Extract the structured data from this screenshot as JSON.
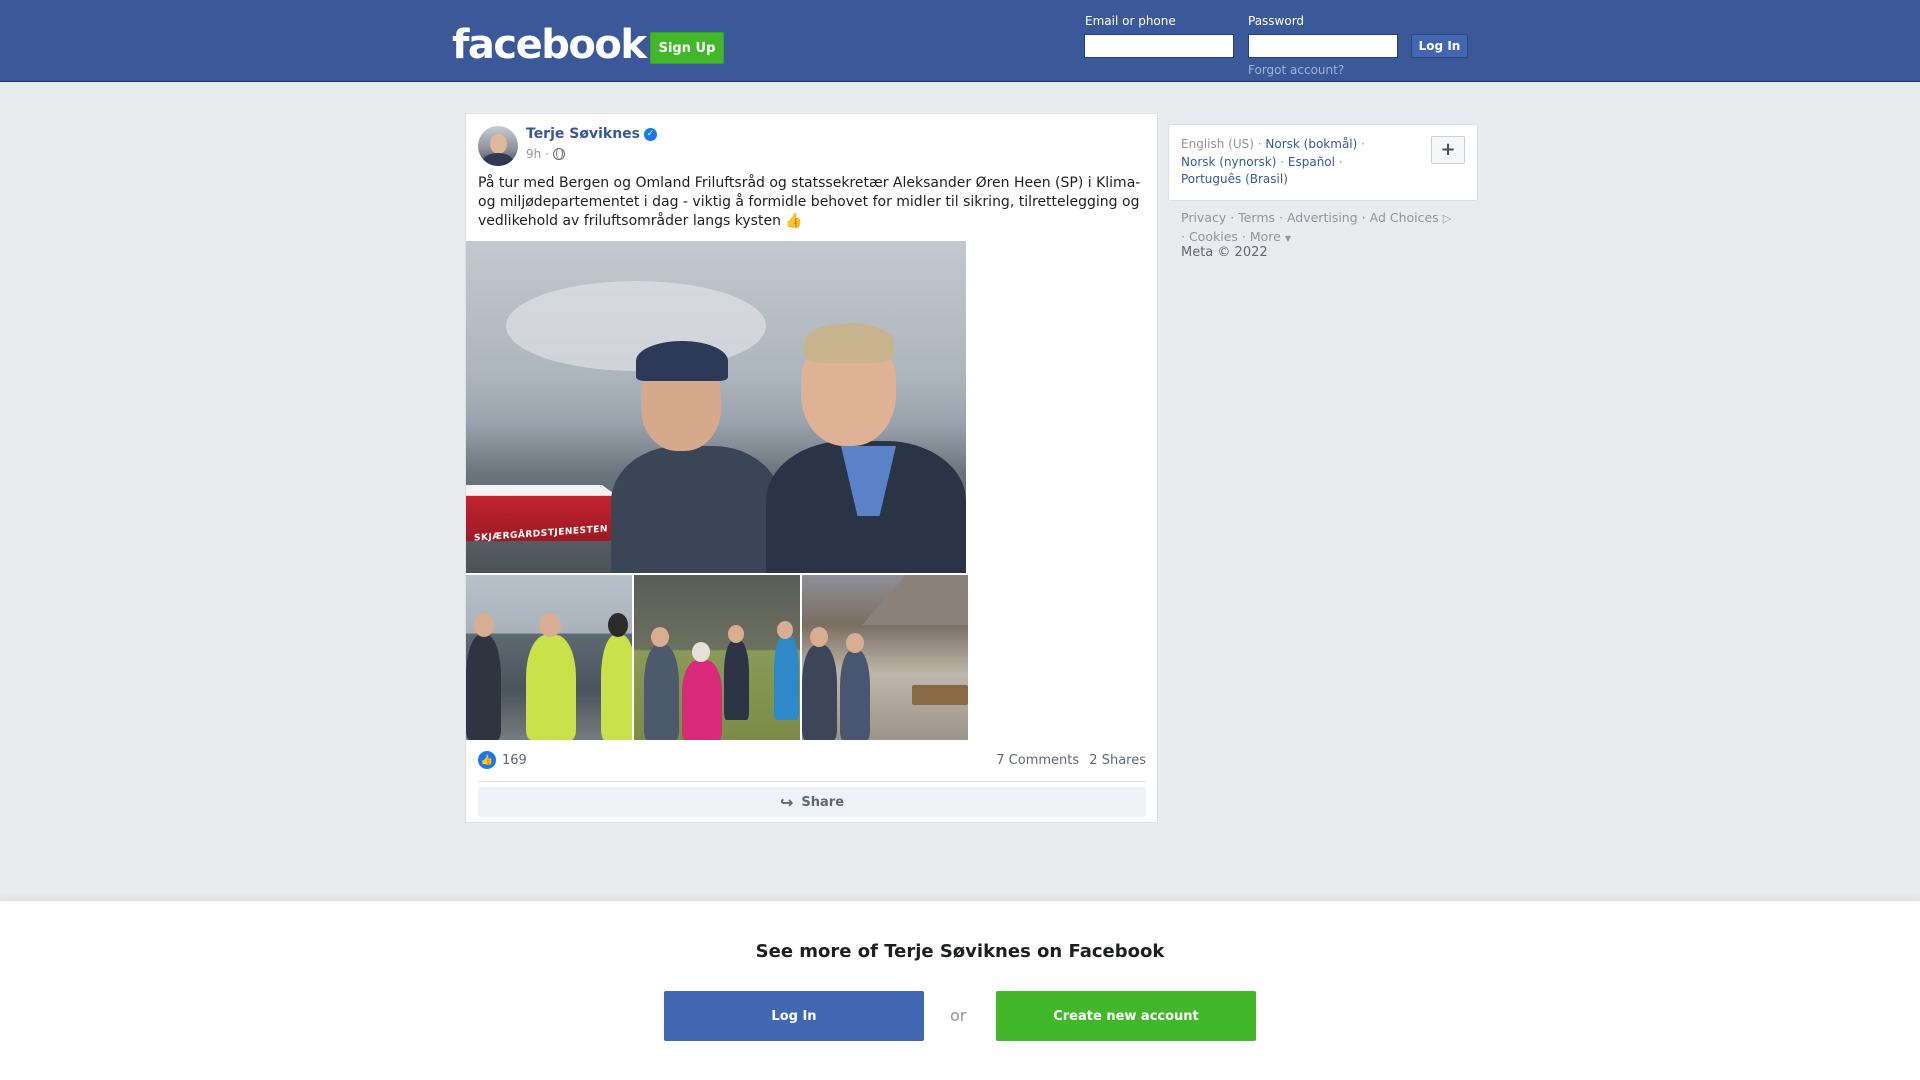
{
  "header": {
    "logo": "facebook",
    "signup_label": "Sign Up",
    "email_label": "Email or phone",
    "email_value": "",
    "password_label": "Password",
    "password_value": "",
    "login_label": "Log In",
    "forgot_label": "Forgot account?"
  },
  "post": {
    "author": "Terje Søviknes",
    "verified_icon": "verified-badge-icon",
    "time": "9h",
    "separator": "·",
    "privacy_icon": "globe-icon",
    "text": "På tur med Bergen og Omland Friluftsråd og statssekretær Aleksander Øren Heen (SP) i Klima- og miljødepartementet i dag - viktig å formidle behovet for midler til sikring, tilrettelegging og vedlikehold av friluftsområder langs kysten 👍",
    "photo_boat_text": "SKJÆRGÅRDSTJENESTEN",
    "likes": "169",
    "comments": "7 Comments",
    "shares": "2 Shares",
    "share_label": "Share"
  },
  "sidebar": {
    "languages": {
      "current": "English (US)",
      "links": [
        "Norsk (bokmål)",
        "Norsk (nynorsk)",
        "Español",
        "Português (Brasil)"
      ],
      "plus": "+"
    },
    "footer": {
      "links": [
        "Privacy",
        "Terms",
        "Advertising",
        "Ad Choices",
        "Cookies",
        "More"
      ],
      "copyright": "Meta © 2022"
    }
  },
  "banner": {
    "title": "See more of Terje Søviknes on Facebook",
    "login_label": "Log In",
    "or_label": "or",
    "create_label": "Create new account"
  },
  "colors": {
    "brand_blue": "#3b5998",
    "button_blue": "#4267b2",
    "green": "#42b72a",
    "link": "#385898"
  }
}
